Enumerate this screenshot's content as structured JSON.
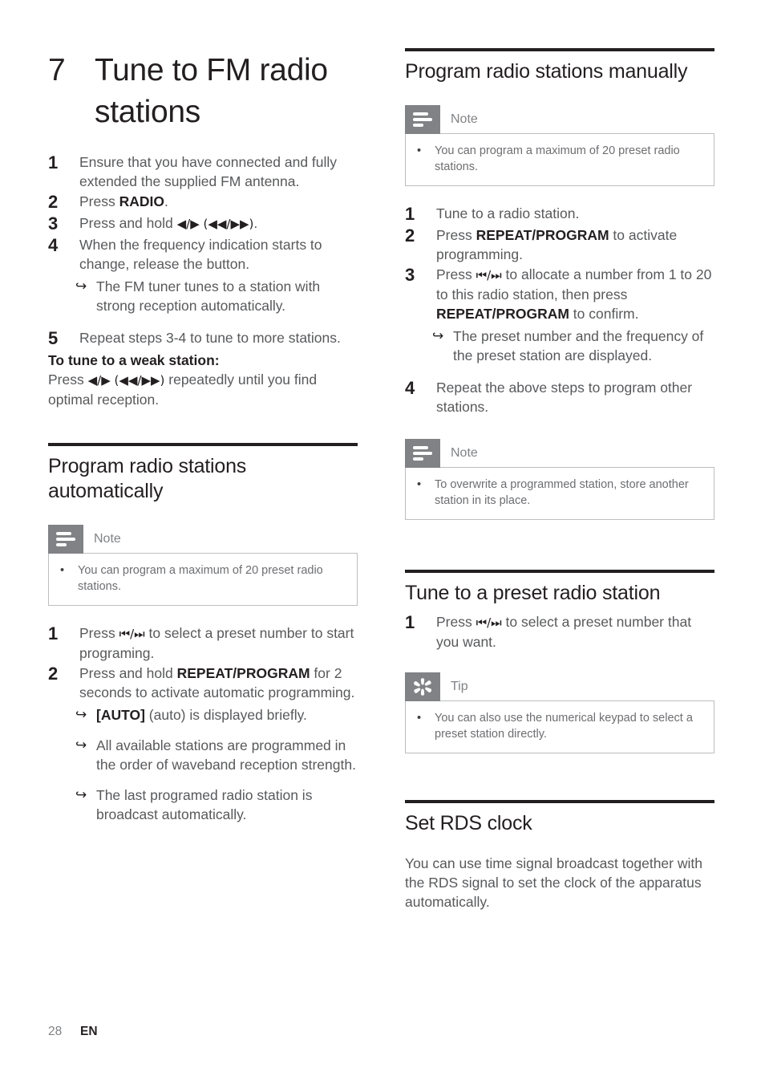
{
  "document": {
    "footer": {
      "page_number": "28",
      "language": "EN"
    },
    "colors": {
      "text_body": "#58595b",
      "text_heading": "#231f20",
      "callout_gray": "#808285",
      "callout_border": "#bcbec0"
    }
  },
  "left_column": {
    "chapter": {
      "number": "7",
      "title": "Tune to FM radio stations"
    },
    "intro_steps": [
      {
        "num": "1",
        "text": "Ensure that you have connected and fully extended the supplied FM antenna."
      },
      {
        "num": "2",
        "text_before": "Press ",
        "bold": "RADIO",
        "text_after": "."
      },
      {
        "num": "3",
        "text_before": "Press and hold ",
        "symbols": "◀/▶ (◀◀/▶▶)",
        "text_after": "."
      },
      {
        "num": "4",
        "text": "When the frequency indication starts to change, release the button.",
        "results": [
          "The FM tuner tunes to a station with strong reception automatically."
        ]
      },
      {
        "num": "5",
        "text": "Repeat steps 3-4 to tune to more stations."
      }
    ],
    "weak_station": {
      "heading": "To tune to a weak station:",
      "text_before": "Press ",
      "symbols": "◀/▶ (◀◀/▶▶)",
      "text_after": " repeatedly until you find optimal reception."
    },
    "section": {
      "title": "Program radio stations automatically",
      "note": {
        "icon": "note-icon",
        "label": "Note",
        "items": [
          "You can program a maximum of 20 preset radio stations."
        ]
      },
      "steps": [
        {
          "num": "1",
          "text_before": "Press ",
          "symbols": "⏮/⏭",
          "text_after": " to select a preset number to start programing."
        },
        {
          "num": "2",
          "text_before": "Press and hold ",
          "bold": "REPEAT/PROGRAM",
          "text_after": " for 2 seconds to activate automatic programming.",
          "results_rich": [
            {
              "bold": "[AUTO]",
              "rest": " (auto) is displayed briefly."
            },
            {
              "bold": "",
              "rest": "All available stations are programmed in the order of waveband reception strength."
            },
            {
              "bold": "",
              "rest": "The last programed radio station is broadcast automatically."
            }
          ]
        }
      ]
    }
  },
  "right_column": {
    "section_manual": {
      "title": "Program radio stations manually",
      "note": {
        "icon": "note-icon",
        "label": "Note",
        "items": [
          "You can program a maximum of 20 preset radio stations."
        ]
      },
      "steps": [
        {
          "num": "1",
          "text": "Tune to a radio station."
        },
        {
          "num": "2",
          "text_before": "Press ",
          "bold": "REPEAT/PROGRAM",
          "text_after": " to activate programming."
        },
        {
          "num": "3",
          "text_before": "Press ",
          "symbols": "⏮/⏭",
          "text_mid": " to allocate a number from 1 to 20 to this radio station, then press ",
          "bold": "REPEAT/PROGRAM",
          "text_after": " to confirm.",
          "results": [
            "The preset number and the frequency of the preset station are displayed."
          ]
        },
        {
          "num": "4",
          "text": "Repeat the above steps to program other stations."
        }
      ],
      "note_overwrite": {
        "icon": "note-icon",
        "label": "Note",
        "items": [
          "To overwrite a programmed station, store another station in its place."
        ]
      }
    },
    "section_preset": {
      "title": "Tune to a preset radio station",
      "steps": [
        {
          "num": "1",
          "text_before": "Press ",
          "symbols": "⏮/⏭",
          "text_after": " to select a preset number that you want."
        }
      ],
      "tip": {
        "icon": "tip-icon",
        "label": "Tip",
        "items": [
          "You can also use the numerical keypad to select a preset station directly."
        ]
      }
    },
    "section_rds": {
      "title": "Set RDS clock",
      "paragraph": "You can use time signal broadcast together with the RDS signal to set the clock of the apparatus automatically."
    }
  }
}
